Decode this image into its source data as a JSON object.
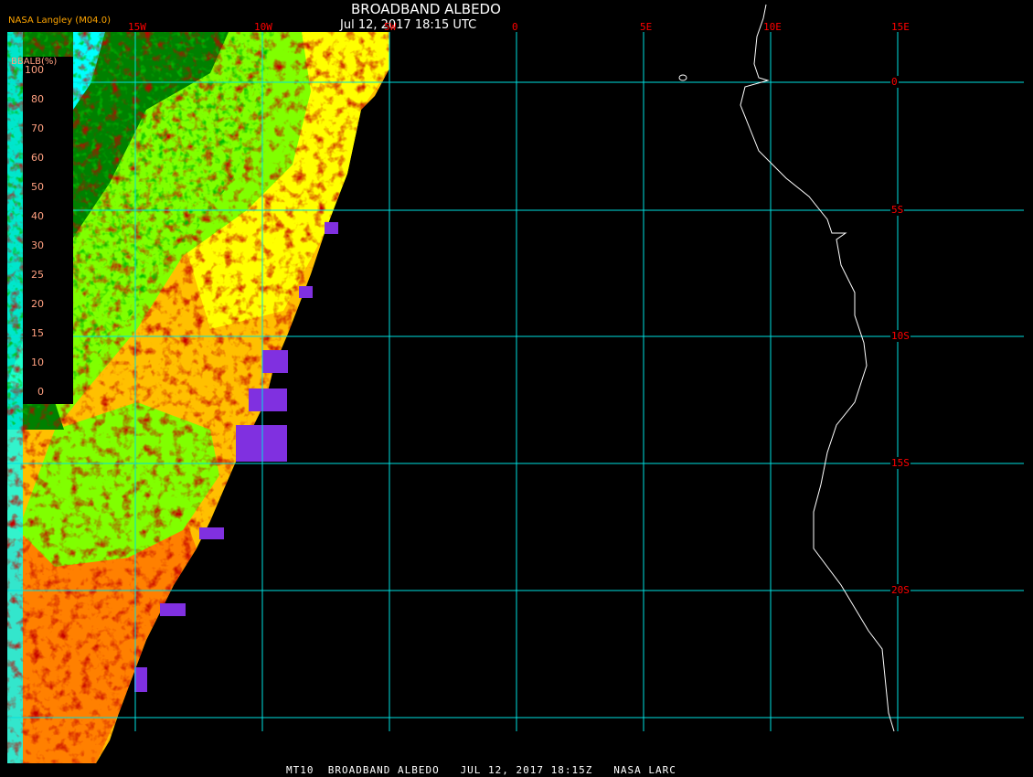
{
  "header": {
    "title": "BROADBAND ALBEDO",
    "datetime": "Jul 12, 2017 18:15 UTC",
    "source": "NASA Langley (M04.0)"
  },
  "longitude_labels": [
    "15W",
    "10W",
    "5W",
    "0",
    "5E",
    "10E",
    "15E"
  ],
  "latitude_labels": [
    "0",
    "5S",
    "10S",
    "15S",
    "20S"
  ],
  "legend": {
    "title": "BBALB(%)",
    "labels": [
      "100",
      "80",
      "70",
      "60",
      "50",
      "40",
      "30",
      "25",
      "20",
      "15",
      "10",
      "0"
    ],
    "colors": [
      "#600000",
      "#f00000",
      "#ff5000",
      "#ffa000",
      "#ffff00",
      "#80ff00",
      "#008000",
      "#00ffff",
      "#0080ff",
      "#0000ff",
      "#8030e0"
    ]
  },
  "footer": "MT10  BROADBAND ALBEDO   JUL 12, 2017 18:15Z   NASA LARC"
}
